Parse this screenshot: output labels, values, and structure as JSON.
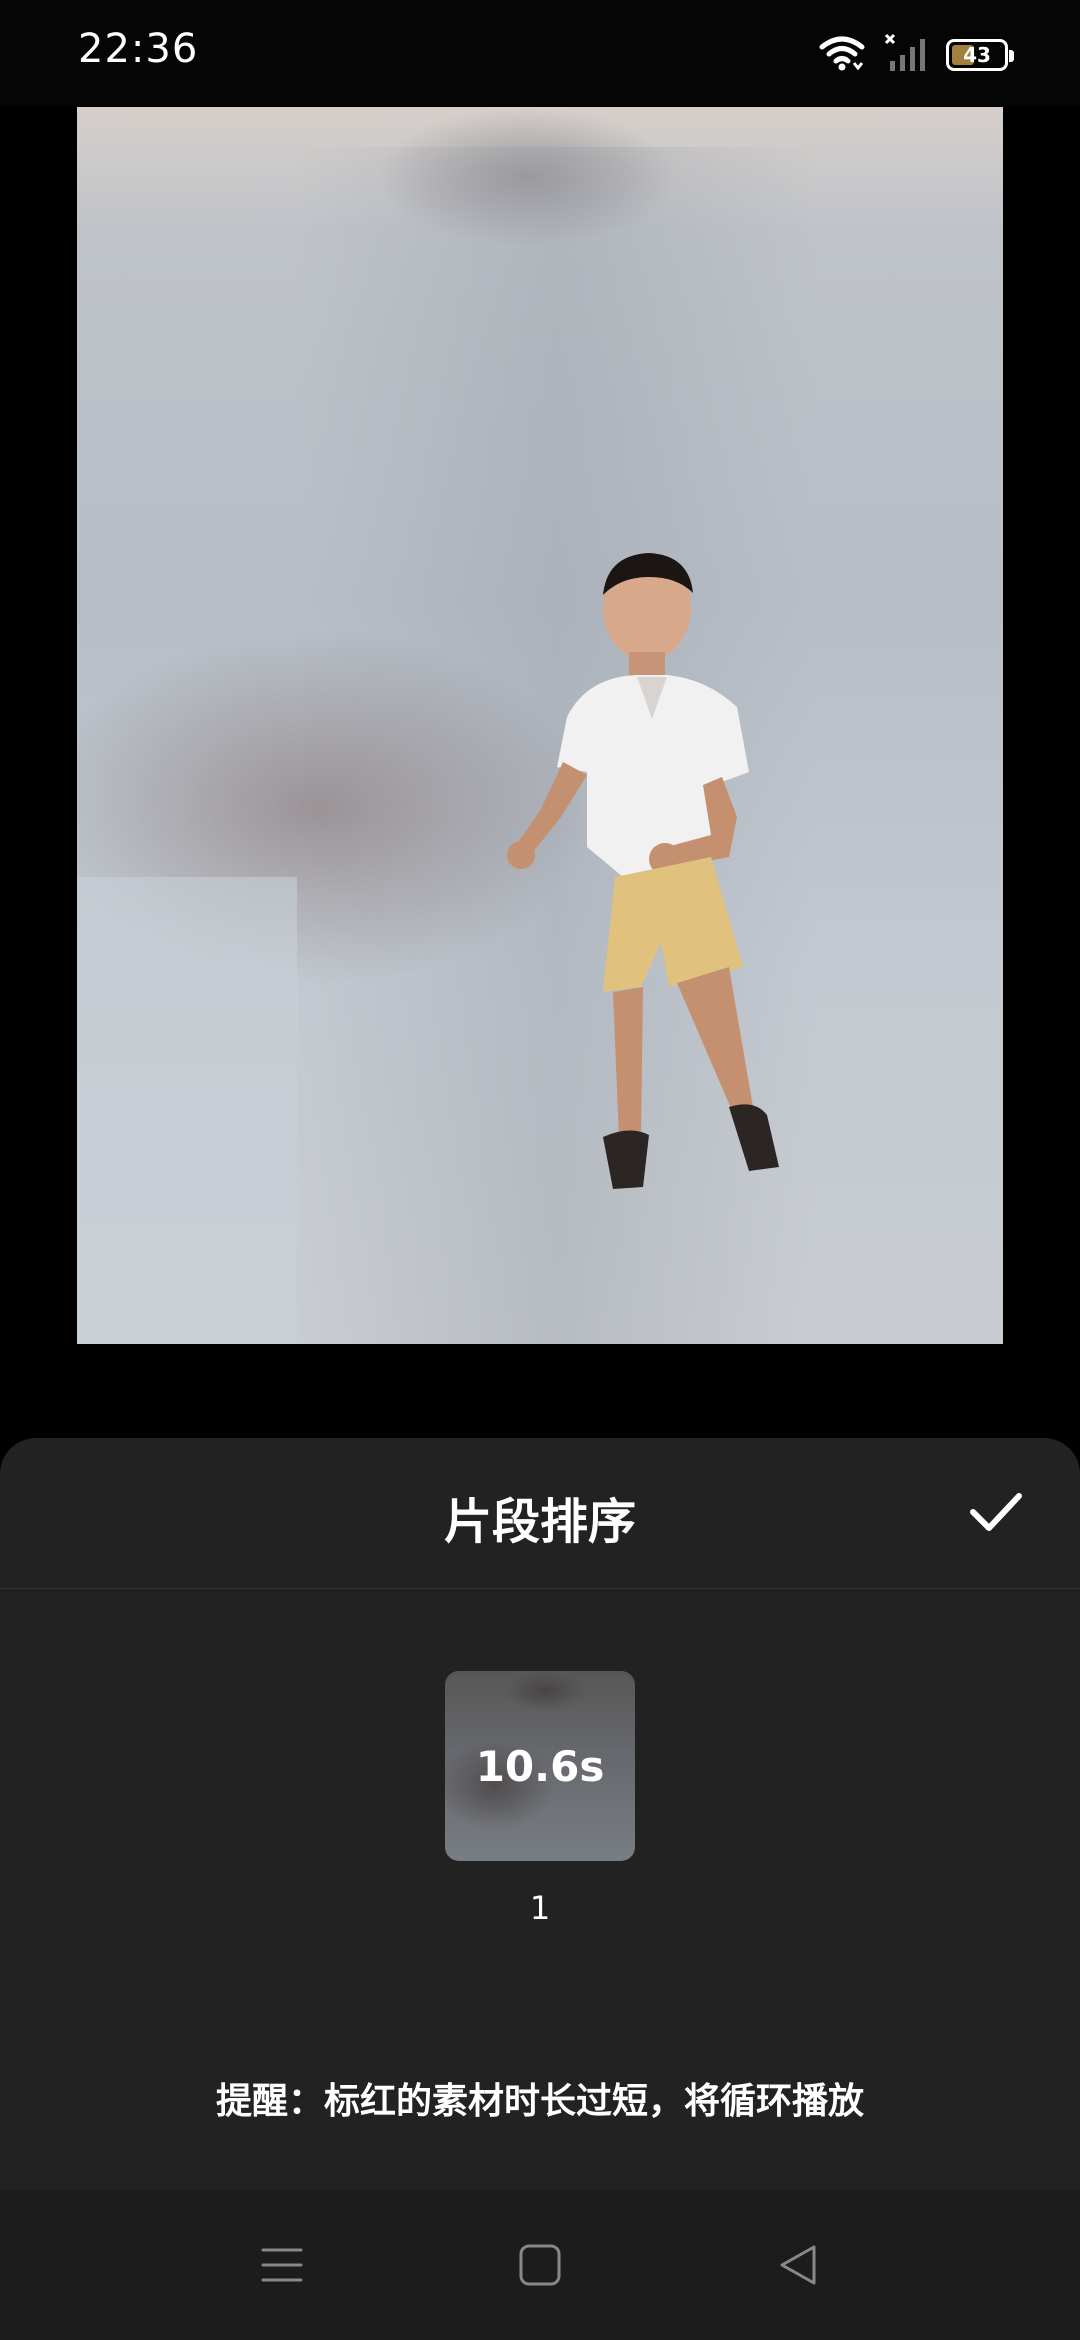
{
  "status_bar": {
    "time": "22:36",
    "battery_level": "43",
    "icons": [
      "wifi-icon",
      "no-signal-icon",
      "battery-icon"
    ]
  },
  "preview": {
    "content": "video-frame"
  },
  "panel": {
    "title": "片段排序",
    "confirm_icon": "check-icon",
    "clips": [
      {
        "duration": "10.6s",
        "index": "1"
      }
    ],
    "reminder": "提醒：标红的素材时长过短，将循环播放"
  },
  "nav_bar": {
    "icons": [
      "menu-icon",
      "home-icon",
      "back-icon"
    ]
  },
  "colors": {
    "panel_bg": "#222222",
    "battery_fill": "#a08140"
  }
}
